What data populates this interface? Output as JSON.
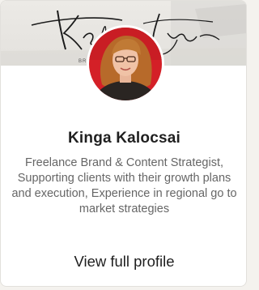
{
  "profile": {
    "name": "Kinga Kalocsai",
    "headline": "Freelance Brand & Content Strategist, Supporting clients with their growth plans and execution, Experience in regional go to market strategies",
    "view_profile_label": "View full profile"
  },
  "banner": {
    "signature_text": "Kalocsai Kinga",
    "subtext": "BR"
  },
  "colors": {
    "banner_bg": "#e6e4e0",
    "avatar_bg": "#d42027",
    "text_primary": "#1f1f1f",
    "text_secondary": "#666666"
  }
}
